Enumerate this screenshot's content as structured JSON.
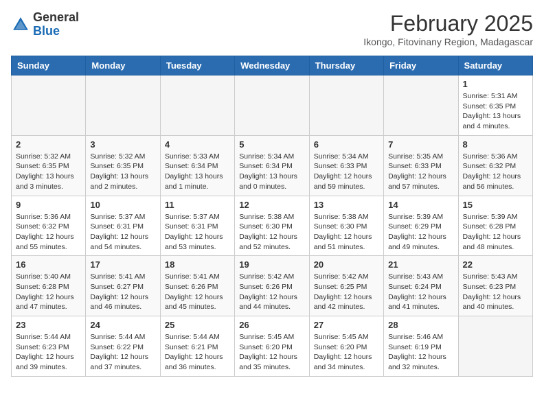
{
  "header": {
    "logo_general": "General",
    "logo_blue": "Blue",
    "month_title": "February 2025",
    "subtitle": "Ikongo, Fitovinany Region, Madagascar"
  },
  "weekdays": [
    "Sunday",
    "Monday",
    "Tuesday",
    "Wednesday",
    "Thursday",
    "Friday",
    "Saturday"
  ],
  "weeks": [
    [
      {
        "day": "",
        "info": ""
      },
      {
        "day": "",
        "info": ""
      },
      {
        "day": "",
        "info": ""
      },
      {
        "day": "",
        "info": ""
      },
      {
        "day": "",
        "info": ""
      },
      {
        "day": "",
        "info": ""
      },
      {
        "day": "1",
        "info": "Sunrise: 5:31 AM\nSunset: 6:35 PM\nDaylight: 13 hours and 4 minutes."
      }
    ],
    [
      {
        "day": "2",
        "info": "Sunrise: 5:32 AM\nSunset: 6:35 PM\nDaylight: 13 hours and 3 minutes."
      },
      {
        "day": "3",
        "info": "Sunrise: 5:32 AM\nSunset: 6:35 PM\nDaylight: 13 hours and 2 minutes."
      },
      {
        "day": "4",
        "info": "Sunrise: 5:33 AM\nSunset: 6:34 PM\nDaylight: 13 hours and 1 minute."
      },
      {
        "day": "5",
        "info": "Sunrise: 5:34 AM\nSunset: 6:34 PM\nDaylight: 13 hours and 0 minutes."
      },
      {
        "day": "6",
        "info": "Sunrise: 5:34 AM\nSunset: 6:33 PM\nDaylight: 12 hours and 59 minutes."
      },
      {
        "day": "7",
        "info": "Sunrise: 5:35 AM\nSunset: 6:33 PM\nDaylight: 12 hours and 57 minutes."
      },
      {
        "day": "8",
        "info": "Sunrise: 5:36 AM\nSunset: 6:32 PM\nDaylight: 12 hours and 56 minutes."
      }
    ],
    [
      {
        "day": "9",
        "info": "Sunrise: 5:36 AM\nSunset: 6:32 PM\nDaylight: 12 hours and 55 minutes."
      },
      {
        "day": "10",
        "info": "Sunrise: 5:37 AM\nSunset: 6:31 PM\nDaylight: 12 hours and 54 minutes."
      },
      {
        "day": "11",
        "info": "Sunrise: 5:37 AM\nSunset: 6:31 PM\nDaylight: 12 hours and 53 minutes."
      },
      {
        "day": "12",
        "info": "Sunrise: 5:38 AM\nSunset: 6:30 PM\nDaylight: 12 hours and 52 minutes."
      },
      {
        "day": "13",
        "info": "Sunrise: 5:38 AM\nSunset: 6:30 PM\nDaylight: 12 hours and 51 minutes."
      },
      {
        "day": "14",
        "info": "Sunrise: 5:39 AM\nSunset: 6:29 PM\nDaylight: 12 hours and 49 minutes."
      },
      {
        "day": "15",
        "info": "Sunrise: 5:39 AM\nSunset: 6:28 PM\nDaylight: 12 hours and 48 minutes."
      }
    ],
    [
      {
        "day": "16",
        "info": "Sunrise: 5:40 AM\nSunset: 6:28 PM\nDaylight: 12 hours and 47 minutes."
      },
      {
        "day": "17",
        "info": "Sunrise: 5:41 AM\nSunset: 6:27 PM\nDaylight: 12 hours and 46 minutes."
      },
      {
        "day": "18",
        "info": "Sunrise: 5:41 AM\nSunset: 6:26 PM\nDaylight: 12 hours and 45 minutes."
      },
      {
        "day": "19",
        "info": "Sunrise: 5:42 AM\nSunset: 6:26 PM\nDaylight: 12 hours and 44 minutes."
      },
      {
        "day": "20",
        "info": "Sunrise: 5:42 AM\nSunset: 6:25 PM\nDaylight: 12 hours and 42 minutes."
      },
      {
        "day": "21",
        "info": "Sunrise: 5:43 AM\nSunset: 6:24 PM\nDaylight: 12 hours and 41 minutes."
      },
      {
        "day": "22",
        "info": "Sunrise: 5:43 AM\nSunset: 6:23 PM\nDaylight: 12 hours and 40 minutes."
      }
    ],
    [
      {
        "day": "23",
        "info": "Sunrise: 5:44 AM\nSunset: 6:23 PM\nDaylight: 12 hours and 39 minutes."
      },
      {
        "day": "24",
        "info": "Sunrise: 5:44 AM\nSunset: 6:22 PM\nDaylight: 12 hours and 37 minutes."
      },
      {
        "day": "25",
        "info": "Sunrise: 5:44 AM\nSunset: 6:21 PM\nDaylight: 12 hours and 36 minutes."
      },
      {
        "day": "26",
        "info": "Sunrise: 5:45 AM\nSunset: 6:20 PM\nDaylight: 12 hours and 35 minutes."
      },
      {
        "day": "27",
        "info": "Sunrise: 5:45 AM\nSunset: 6:20 PM\nDaylight: 12 hours and 34 minutes."
      },
      {
        "day": "28",
        "info": "Sunrise: 5:46 AM\nSunset: 6:19 PM\nDaylight: 12 hours and 32 minutes."
      },
      {
        "day": "",
        "info": ""
      }
    ]
  ]
}
